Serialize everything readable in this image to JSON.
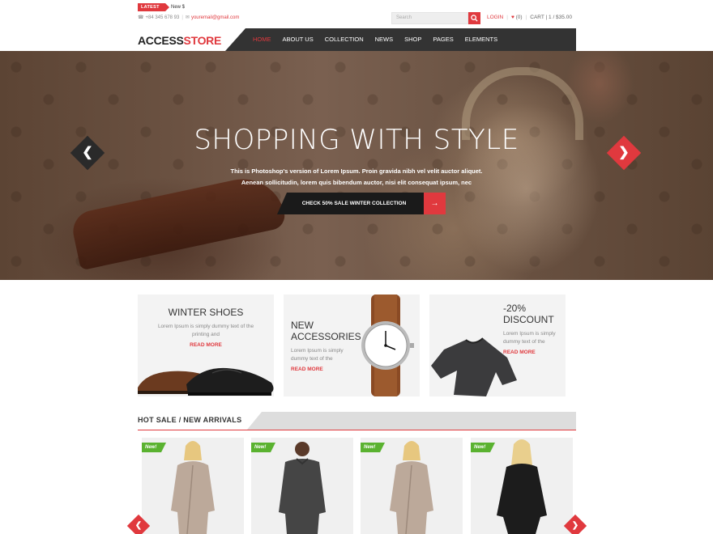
{
  "topbar": {
    "latest_badge": "LATEST",
    "latest_text": "New $",
    "phone": "+84 345 678 93",
    "email": "youremail@gmail.com",
    "search_placeholder": "Search",
    "login": "LOGIN",
    "wishlist_count": "(0)",
    "cart": "CART | 1 / $35.00"
  },
  "header": {
    "logo_access": "ACCESS",
    "logo_store": "STORE",
    "nav": [
      "HOME",
      "ABOUT US",
      "COLLECTION",
      "NEWS",
      "SHOP",
      "PAGES",
      "ELEMENTS"
    ],
    "active_index": 0
  },
  "hero": {
    "title": "SHOPPING WITH STYLE",
    "subtitle_line1": "This is Photoshop's version of Lorem Ipsum. Proin gravida nibh vel velit auctor aliquet.",
    "subtitle_line2": "Aenean sollicitudin, lorem quis bibendum auctor, nisi elit consequat ipsum, nec",
    "cta": "CHECK 50% SALE WINTER COLLECTION",
    "cta_arrow": "→"
  },
  "promos": [
    {
      "title": "WINTER SHOES",
      "desc": "Lorem Ipsum is simply dummy text of the printing and",
      "link": "READ MORE"
    },
    {
      "title_line1": "NEW",
      "title_line2": "ACCESSORIES",
      "desc": "Lorem Ipsum is simply dummy text of the",
      "link": "READ MORE"
    },
    {
      "title_line1": "-20%",
      "title_line2": "DISCOUNT",
      "desc": "Lorem Ipsum is simply dummy text of the",
      "link": "READ MORE"
    }
  ],
  "hot_sale": {
    "title": "HOT SALE  /  NEW ARRIVALS",
    "products": [
      {
        "badge": "New!"
      },
      {
        "badge": "New!"
      },
      {
        "badge": "New!"
      },
      {
        "badge": "New!"
      }
    ]
  },
  "colors": {
    "accent": "#e0393e",
    "dark": "#333333",
    "new_badge": "#5ab230"
  }
}
